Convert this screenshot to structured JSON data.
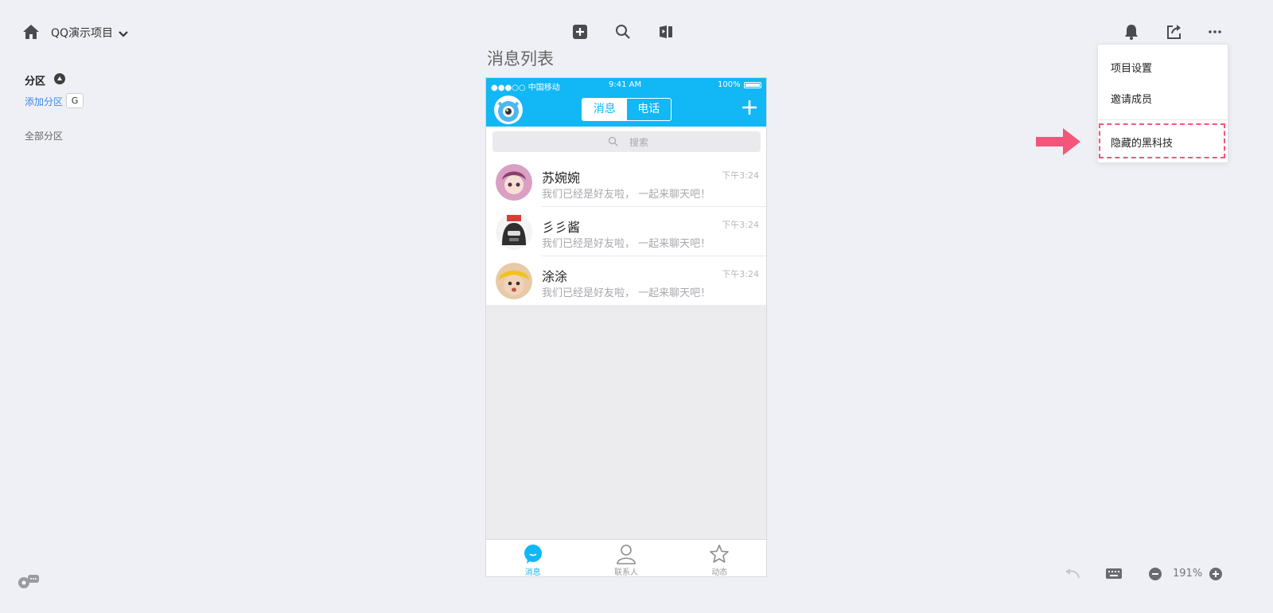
{
  "topbar": {
    "project_title": "QQ演示项目",
    "icons": [
      "home-icon",
      "chevron-down-icon",
      "add-icon",
      "search-icon",
      "preview-icon",
      "bell-icon",
      "share-icon",
      "more-icon"
    ]
  },
  "sidebar": {
    "section_title": "分区",
    "add_section": "添加分区",
    "shortcut_key": "G",
    "all_sections": "全部分区"
  },
  "page_title": "消息列表",
  "phone": {
    "status": {
      "carrier": "●●●○○ 中国移动",
      "time": "9:41 AM",
      "battery": "100%"
    },
    "segments": [
      "消息",
      "电话"
    ],
    "search_placeholder": "搜索",
    "chats": [
      {
        "name": "苏婉婉",
        "preview": "我们已经是好友啦， 一起来聊天吧！",
        "time": "下午3:24",
        "avatar_color": "#b86b9a"
      },
      {
        "name": "彡彡酱",
        "preview": "我们已经是好友啦， 一起来聊天吧！",
        "time": "下午3:24",
        "avatar_color": "#3a3a3a"
      },
      {
        "name": "涂涂",
        "preview": "我们已经是好友啦， 一起来聊天吧！",
        "time": "下午3:24",
        "avatar_color": "#e0b090"
      }
    ],
    "tabs": [
      {
        "label": "消息",
        "icon": "message-icon",
        "active": true
      },
      {
        "label": "联系人",
        "icon": "contacts-icon",
        "active": false
      },
      {
        "label": "动态",
        "icon": "star-icon",
        "active": false
      }
    ]
  },
  "menu": {
    "items": [
      "项目设置",
      "邀请成员",
      "隐藏的黑科技"
    ],
    "highlight_color": "#f4557a"
  },
  "bottombar": {
    "zoom": "191%"
  },
  "colors": {
    "accent": "#12b7f5",
    "link": "#3d88e8",
    "arrow": "#f4557a"
  }
}
